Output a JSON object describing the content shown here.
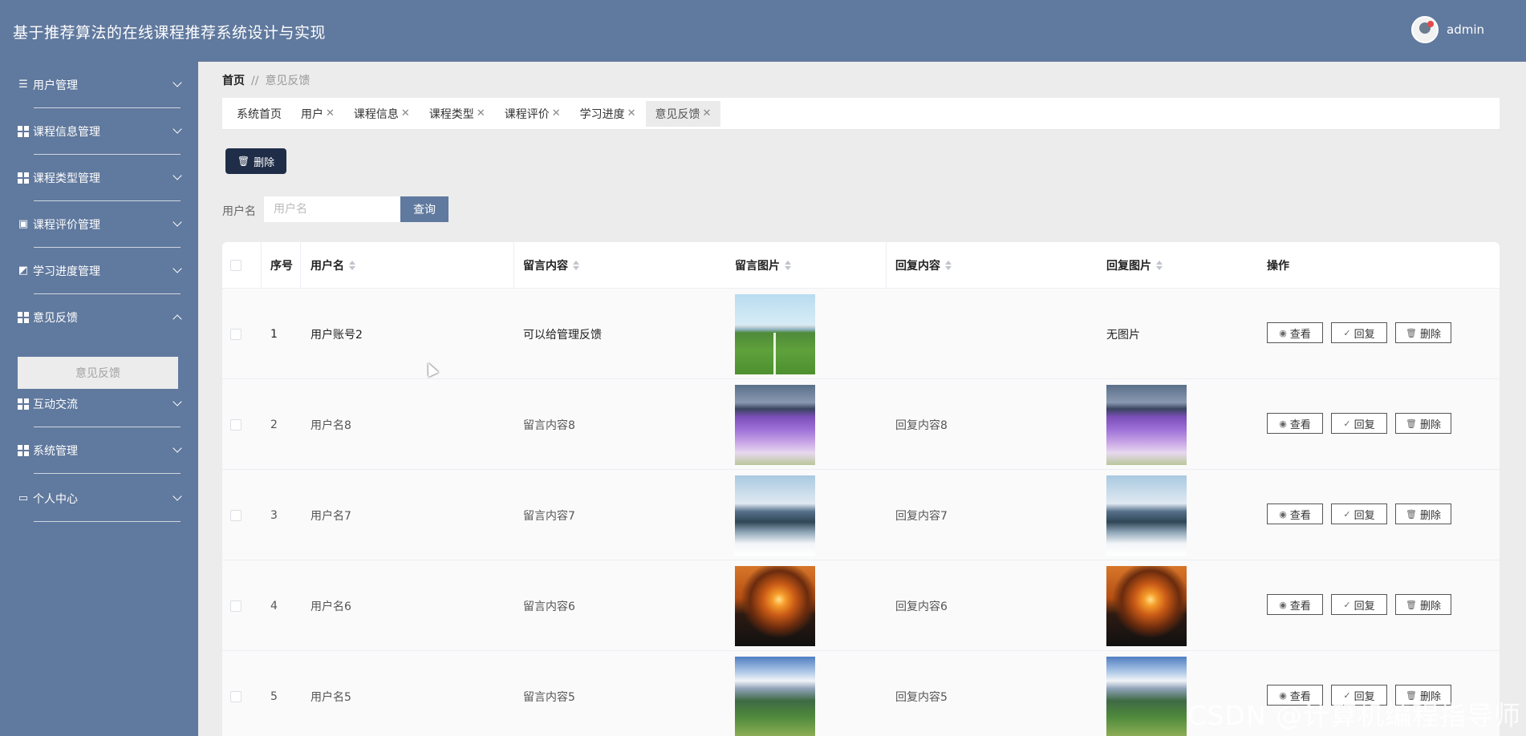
{
  "app": {
    "title": "基于推荐算法的在线课程推荐系统设计与实现",
    "username": "admin"
  },
  "sidebar": {
    "items": [
      {
        "label": "用户管理",
        "icon": "sliders-icon",
        "expanded": false
      },
      {
        "label": "课程信息管理",
        "icon": "grid-icon",
        "expanded": false
      },
      {
        "label": "课程类型管理",
        "icon": "grid-icon",
        "expanded": false
      },
      {
        "label": "课程评价管理",
        "icon": "clipboard-icon",
        "expanded": false
      },
      {
        "label": "学习进度管理",
        "icon": "chart-icon",
        "expanded": false
      },
      {
        "label": "意见反馈",
        "icon": "grid-icon",
        "expanded": true
      },
      {
        "label": "互动交流",
        "icon": "grid-icon",
        "expanded": false
      },
      {
        "label": "系统管理",
        "icon": "grid-icon",
        "expanded": false
      },
      {
        "label": "个人中心",
        "icon": "card-icon",
        "expanded": false
      }
    ],
    "sub_item": "意见反馈"
  },
  "breadcrumb": {
    "home": "首页",
    "separator": "//",
    "current": "意见反馈"
  },
  "tabs": [
    {
      "label": "系统首页",
      "closable": false
    },
    {
      "label": "用户",
      "closable": true
    },
    {
      "label": "课程信息",
      "closable": true
    },
    {
      "label": "课程类型",
      "closable": true
    },
    {
      "label": "课程评价",
      "closable": true
    },
    {
      "label": "学习进度",
      "closable": true
    },
    {
      "label": "意见反馈",
      "closable": true,
      "active": true
    }
  ],
  "toolbar": {
    "delete_label": "删除"
  },
  "search": {
    "label": "用户名",
    "placeholder": "用户名",
    "button": "查询"
  },
  "table": {
    "headers": [
      "序号",
      "用户名",
      "留言内容",
      "留言图片",
      "回复内容",
      "回复图片",
      "操作"
    ],
    "actions": [
      "查看",
      "回复",
      "删除"
    ],
    "rows": [
      {
        "index": "1",
        "username": "用户账号2",
        "message": "可以给管理反馈",
        "msg_image": "solar",
        "reply": "",
        "reply_image": "无图片"
      },
      {
        "index": "2",
        "username": "用户名8",
        "message": "留言内容8",
        "msg_image": "lavender",
        "reply": "回复内容8",
        "reply_image": "lavender"
      },
      {
        "index": "3",
        "username": "用户名7",
        "message": "留言内容7",
        "msg_image": "snow",
        "reply": "回复内容7",
        "reply_image": "snow"
      },
      {
        "index": "4",
        "username": "用户名6",
        "message": "留言内容6",
        "msg_image": "sunset",
        "reply": "回复内容6",
        "reply_image": "sunset"
      },
      {
        "index": "5",
        "username": "用户名5",
        "message": "留言内容5",
        "msg_image": "mountain",
        "reply": "回复内容5",
        "reply_image": "mountain"
      }
    ]
  },
  "watermark": "CSDN @计算机编程指导师",
  "colors": {
    "header": "#60799e",
    "sidebar": "#60799e",
    "primary_dark": "#1f2d48"
  }
}
